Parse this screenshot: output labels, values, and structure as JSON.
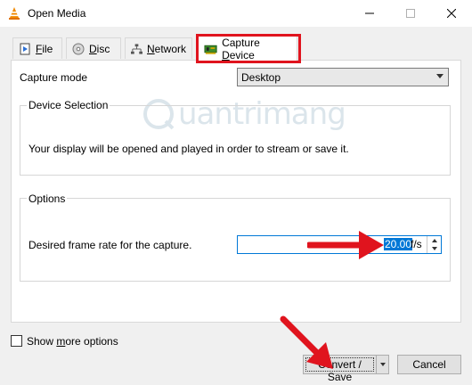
{
  "window": {
    "title": "Open Media"
  },
  "tabs": [
    {
      "label": "File",
      "mnemonic": "F",
      "rest": "ile"
    },
    {
      "label": "Disc",
      "mnemonic": "D",
      "rest": "isc"
    },
    {
      "label": "Network",
      "mnemonic": "N",
      "rest": "etwork"
    },
    {
      "label": "Capture Device",
      "prefix": "Capture ",
      "mnemonic": "D",
      "rest": "evice",
      "selected": true
    }
  ],
  "capture": {
    "mode_label": "Capture mode",
    "mode_value": "Desktop"
  },
  "device_selection": {
    "title": "Device Selection",
    "description": "Your display will be opened and played in order to stream or save it."
  },
  "options": {
    "title": "Options",
    "frame_rate_label": "Desired frame rate for the capture.",
    "frame_rate_value": "20.00",
    "frame_rate_unit": "f/s"
  },
  "watermark": {
    "text": "uantrimang"
  },
  "footer": {
    "show_more_pre": "Show ",
    "show_more_mnemonic": "m",
    "show_more_rest": "ore options",
    "show_more_checked": false,
    "convert_label": "Convert / Save",
    "cancel_label": "Cancel"
  },
  "colors": {
    "highlight": "#e0141e",
    "accent": "#0078d7"
  }
}
